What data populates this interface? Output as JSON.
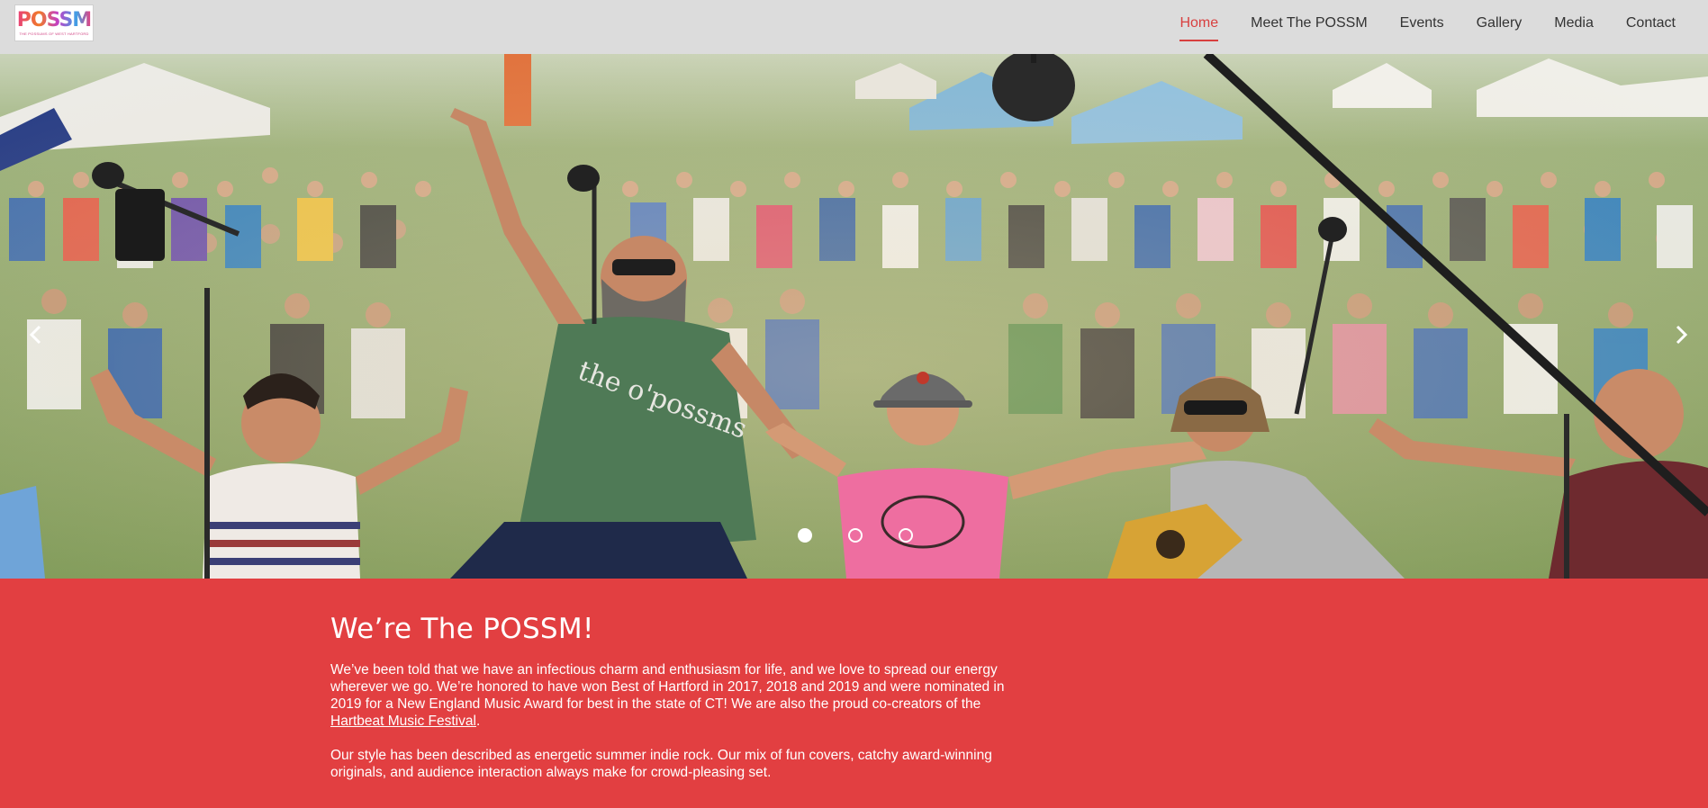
{
  "logo": {
    "wordmark": "POSSM",
    "tagline": "THE POSSUMS OF WEST HARTFORD",
    "alt": "The POSSM logo"
  },
  "nav": {
    "items": [
      {
        "label": "Home",
        "active": true
      },
      {
        "label": "Meet The POSSM",
        "active": false
      },
      {
        "label": "Events",
        "active": false
      },
      {
        "label": "Gallery",
        "active": false
      },
      {
        "label": "Media",
        "active": false
      },
      {
        "label": "Contact",
        "active": false
      }
    ]
  },
  "slider": {
    "slide_count": 3,
    "active_index": 0,
    "prev_icon": "chevron-left-icon",
    "next_icon": "chevron-right-icon"
  },
  "intro": {
    "title": "We’re The POSSM!",
    "paragraph1_before_link": "We’ve been told that we have an infectious charm and enthusiasm for life, and we love to spread our energy wherever we go. We’re honored to have won Best of Hartford in 2017, 2018 and 2019 and were nominated in 2019 for a New England Music Award for best in the state of CT! We are also the proud co-creators of the ",
    "paragraph1_link": "Hartbeat Music Festival",
    "paragraph1_after_link": ".",
    "paragraph2": "Our style has been described as energetic summer indie rock. Our mix of fun covers, catchy  award-winning originals,  and audience interaction always make for  crowd-pleasing set."
  },
  "colors": {
    "header_bg": "#dcdcdc",
    "accent": "#d8403f",
    "intro_bg": "#e23f41",
    "nav_text": "#333333"
  }
}
